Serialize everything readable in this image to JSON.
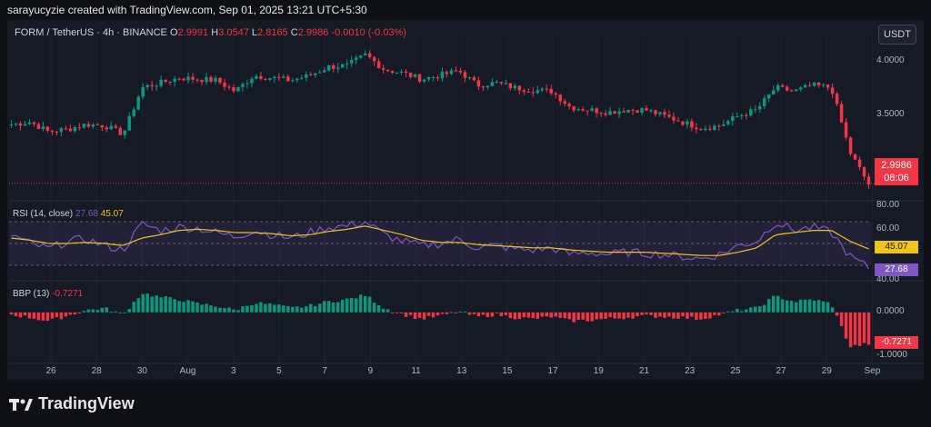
{
  "header": {
    "credit": "sarayucyzie created with TradingView.com, Sep 01, 2025 13:21 UTC+5:30"
  },
  "legend": {
    "symbol": "FORM / TetherUS · 4h · BINANCE",
    "o_label": "O",
    "o": "2.9991",
    "h_label": "H",
    "h": "3.0547",
    "l_label": "L",
    "l": "2.8165",
    "c_label": "C",
    "c": "2.9986",
    "change": "-0.0010 (-0.03%)"
  },
  "currency_button": "USDT",
  "price_tag": {
    "price": "2.9986",
    "countdown": "08:06"
  },
  "price_axis": [
    "4.0000",
    "3.5000"
  ],
  "rsi": {
    "label": "RSI (14, close)",
    "value": "27.68",
    "ma": "45.07",
    "axis": [
      "80.00",
      "60.00",
      "40.00"
    ]
  },
  "bbp": {
    "label": "BBP (13)",
    "value": "-0.7271",
    "axis": [
      "0.0000",
      "-1.0000"
    ]
  },
  "x_axis": [
    "26",
    "28",
    "30",
    "Aug",
    "3",
    "5",
    "7",
    "9",
    "11",
    "13",
    "15",
    "17",
    "19",
    "21",
    "23",
    "25",
    "27",
    "29",
    "Sep"
  ],
  "brand": "TradingView",
  "colors": {
    "up": "#089981",
    "down": "#f23645",
    "rsi": "#7e57c2",
    "rsi_ma": "#f0c419",
    "bg": "#161a25"
  },
  "chart_data": [
    {
      "type": "candlestick",
      "title": "FORM / TetherUS · 4h · BINANCE",
      "x": [
        "26",
        "28",
        "30",
        "Aug",
        "3",
        "5",
        "7",
        "9",
        "11",
        "13",
        "15",
        "17",
        "19",
        "21",
        "23",
        "25",
        "27",
        "29",
        "Sep"
      ],
      "close_path": [
        3.48,
        3.5,
        3.42,
        3.44,
        3.48,
        3.47,
        3.4,
        3.78,
        3.82,
        3.86,
        3.85,
        3.84,
        3.75,
        3.88,
        3.86,
        3.84,
        3.88,
        3.95,
        3.96,
        4.05,
        3.93,
        3.9,
        3.85,
        3.88,
        3.92,
        3.8,
        3.82,
        3.78,
        3.76,
        3.75,
        3.62,
        3.6,
        3.58,
        3.6,
        3.6,
        3.55,
        3.5,
        3.45,
        3.47,
        3.55,
        3.6,
        3.78,
        3.75,
        3.8,
        3.78,
        3.25,
        2.99
      ],
      "ylim": [
        2.9,
        4.2
      ],
      "last": 2.9986
    },
    {
      "type": "line",
      "title": "RSI (14, close)",
      "series": [
        {
          "name": "RSI",
          "values": [
            58,
            50,
            45,
            52,
            54,
            48,
            44,
            68,
            62,
            65,
            64,
            60,
            56,
            62,
            58,
            55,
            60,
            65,
            66,
            70,
            58,
            52,
            48,
            50,
            54,
            46,
            48,
            45,
            44,
            46,
            40,
            42,
            40,
            42,
            41,
            40,
            38,
            36,
            40,
            48,
            52,
            70,
            62,
            65,
            60,
            38,
            27.68
          ]
        },
        {
          "name": "MA",
          "values": [
            55,
            53,
            50,
            50,
            51,
            50,
            48,
            55,
            58,
            62,
            63,
            62,
            60,
            60,
            59,
            57,
            58,
            61,
            63,
            66,
            62,
            58,
            53,
            51,
            51,
            49,
            48,
            47,
            46,
            46,
            44,
            43,
            42,
            42,
            42,
            41,
            40,
            39,
            39,
            42,
            46,
            58,
            60,
            62,
            62,
            52,
            45.07
          ]
        }
      ],
      "ylim": [
        20,
        85
      ]
    },
    {
      "type": "bar",
      "title": "BBP (13)",
      "values": [
        -0.05,
        -0.12,
        -0.2,
        -0.08,
        0.05,
        0.1,
        -0.05,
        0.45,
        0.35,
        0.3,
        0.2,
        0.15,
        0.05,
        0.22,
        0.18,
        0.1,
        0.15,
        0.25,
        0.3,
        0.4,
        0.1,
        -0.05,
        -0.15,
        -0.08,
        0.02,
        -0.1,
        -0.05,
        -0.12,
        -0.15,
        -0.1,
        -0.2,
        -0.18,
        -0.15,
        -0.12,
        -0.08,
        -0.1,
        -0.12,
        -0.15,
        -0.05,
        0.05,
        0.1,
        0.38,
        0.25,
        0.3,
        0.2,
        -0.8,
        -0.7271
      ],
      "ylim": [
        -1.1,
        0.65
      ]
    }
  ]
}
